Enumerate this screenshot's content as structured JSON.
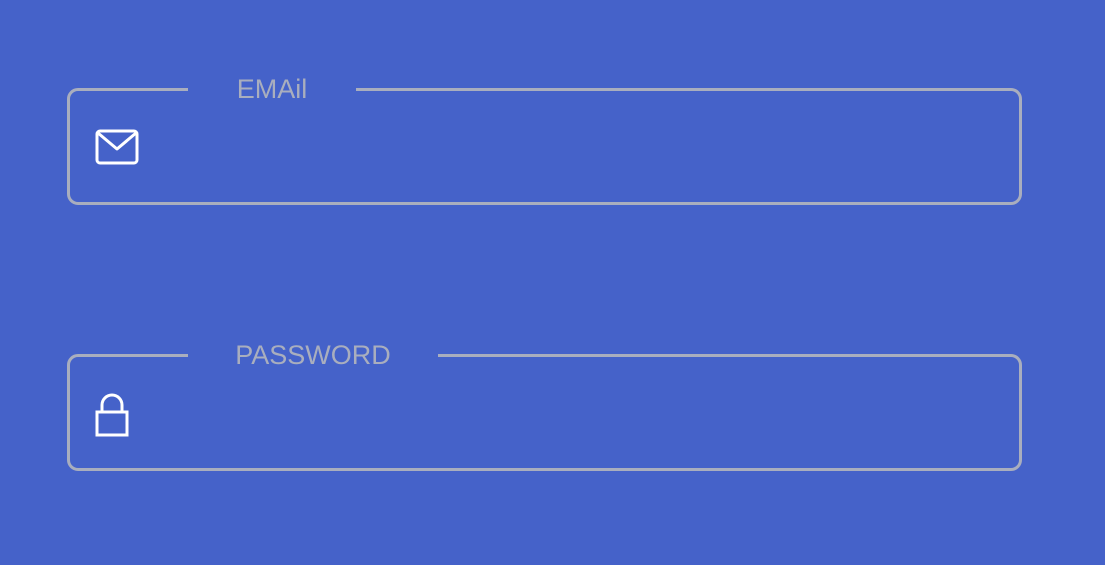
{
  "form": {
    "email": {
      "label": "EMAil",
      "value": "",
      "placeholder": "",
      "icon": "mail-icon"
    },
    "password": {
      "label": "PASSWORD",
      "value": "",
      "placeholder": "",
      "icon": "lock-icon"
    }
  },
  "colors": {
    "background": "#4562C9",
    "border": "#A9AEBE",
    "label": "#A9AEBE",
    "icon": "#FFFFFF"
  }
}
